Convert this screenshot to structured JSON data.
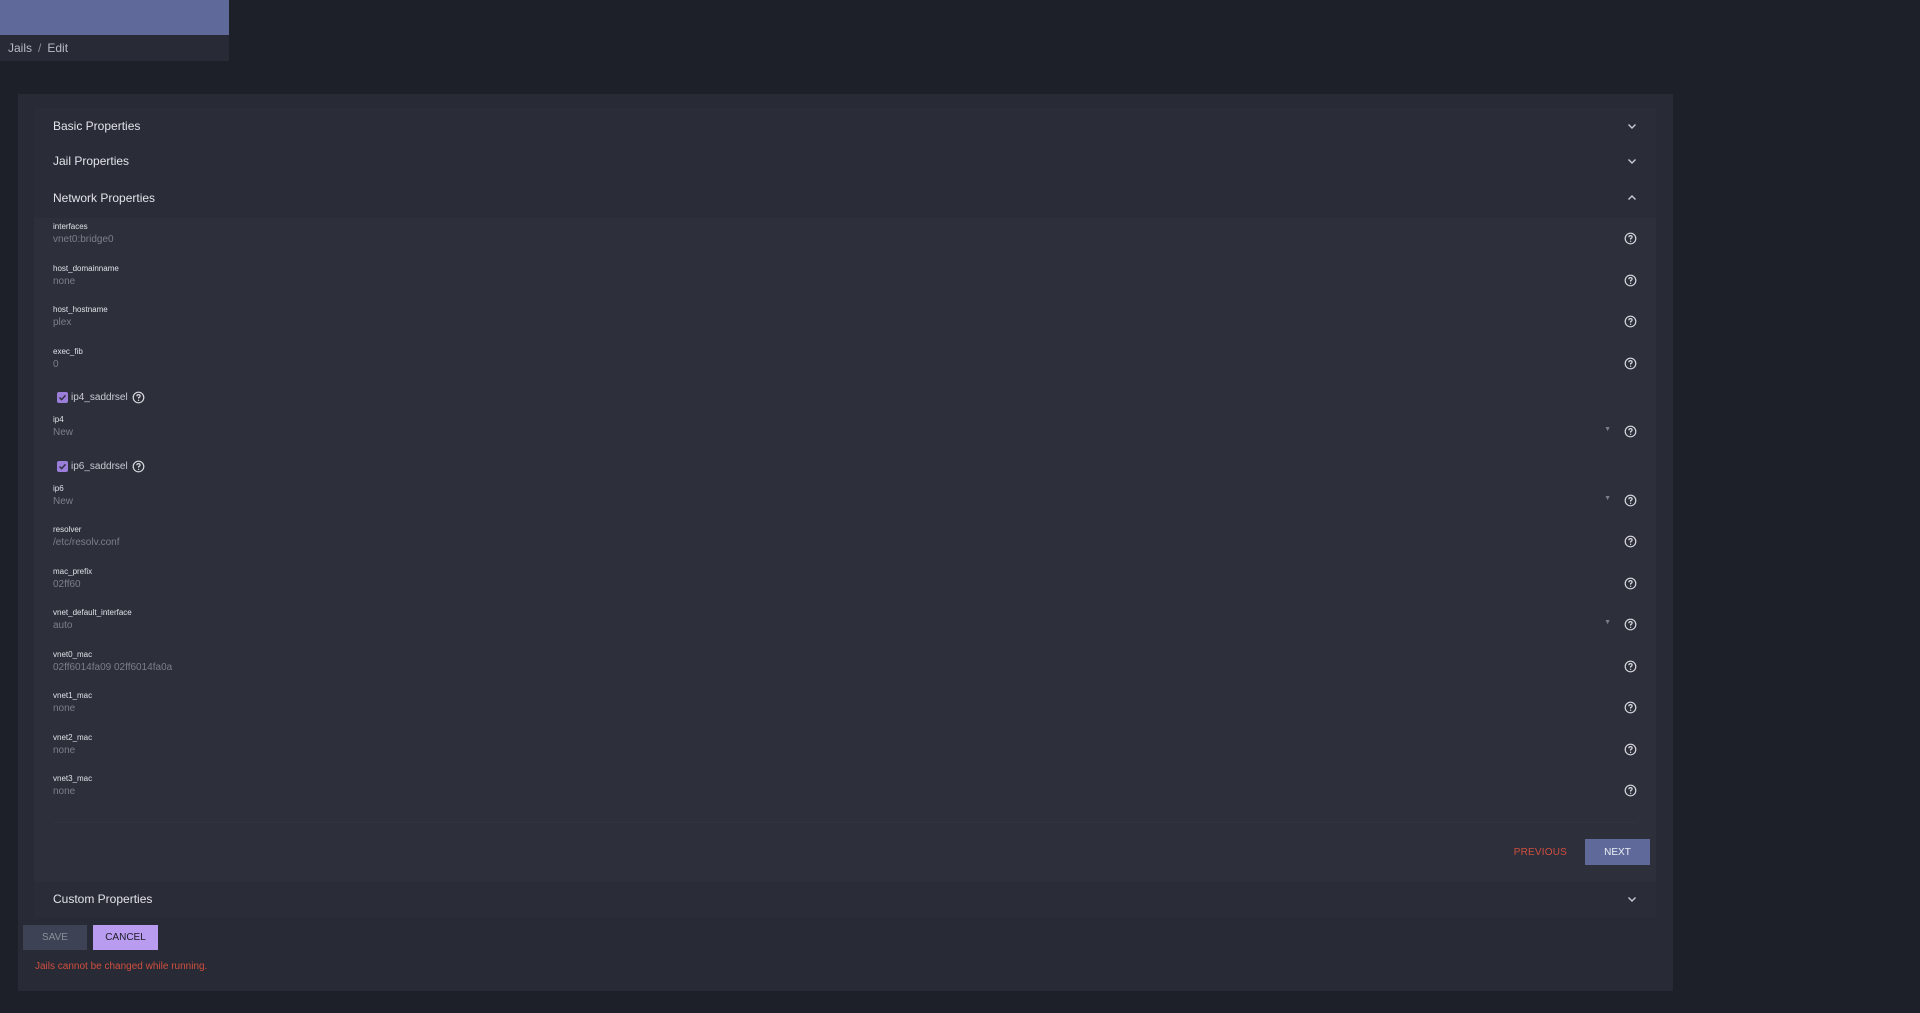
{
  "breadcrumb": {
    "items": [
      "Jails",
      "Edit"
    ],
    "separator": "/"
  },
  "steps": {
    "basic": "Basic Properties",
    "jail": "Jail Properties",
    "network": "Network Properties",
    "custom": "Custom Properties"
  },
  "fields": {
    "interfaces": {
      "label": "interfaces",
      "value": "vnet0:bridge0"
    },
    "host_domainname": {
      "label": "host_domainname",
      "value": "none"
    },
    "host_hostname": {
      "label": "host_hostname",
      "value": "plex"
    },
    "exec_fib": {
      "label": "exec_fib",
      "value": "0"
    },
    "ip4_saddrsel": {
      "label": "ip4_saddrsel",
      "checked": true
    },
    "ip4": {
      "label": "ip4",
      "value": "New"
    },
    "ip6_saddrsel": {
      "label": "ip6_saddrsel",
      "checked": true
    },
    "ip6": {
      "label": "ip6",
      "value": "New"
    },
    "resolver": {
      "label": "resolver",
      "value": "/etc/resolv.conf"
    },
    "mac_prefix": {
      "label": "mac_prefix",
      "value": "02ff60"
    },
    "vnet_default_interface": {
      "label": "vnet_default_interface",
      "value": "auto"
    },
    "vnet0_mac": {
      "label": "vnet0_mac",
      "value": "02ff6014fa09 02ff6014fa0a"
    },
    "vnet1_mac": {
      "label": "vnet1_mac",
      "value": "none"
    },
    "vnet2_mac": {
      "label": "vnet2_mac",
      "value": "none"
    },
    "vnet3_mac": {
      "label": "vnet3_mac",
      "value": "none"
    }
  },
  "nav": {
    "previous": "PREVIOUS",
    "next": "NEXT"
  },
  "actions": {
    "save": "SAVE",
    "cancel": "CANCEL"
  },
  "error": "Jails cannot be changed while running.",
  "colors": {
    "accent": "#5f6a9b",
    "cancel": "#b99cf0",
    "error": "#d04f3e",
    "checkbox": "#9a7ed9"
  }
}
